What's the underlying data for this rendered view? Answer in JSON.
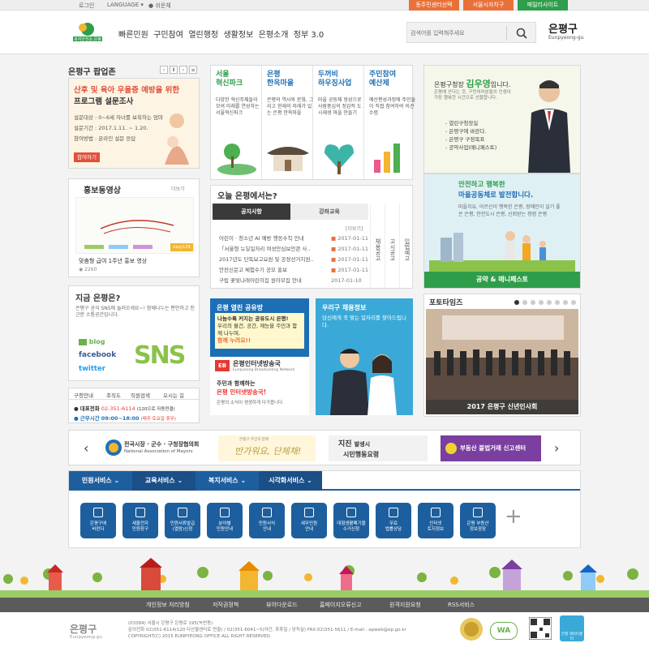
{
  "topbar": {
    "login": "로그인",
    "language": "LANGUAGE",
    "easy": "쉬운체",
    "btn_dong": "동주민센터선택",
    "btn_seoul": "서울시자치구",
    "btn_family": "패밀리사이트",
    "color_orange": "#e8713a",
    "color_green": "#2f9e4a"
  },
  "header": {
    "logo_sub": "복지안전순,은평",
    "nav": "빠른민원  구민참여  열린행정  생활정보  은평소개  정부 3.0",
    "search_placeholder": "검색어를 입력해주세요",
    "brand": "은평구",
    "brand_en": "Eunpyeong-gu"
  },
  "popup": {
    "title": "은평구 팝업존",
    "headline1": "산후 및 육아 우울증 예방을 위한",
    "headline2": "프로그램 설문조사",
    "line1": "설문대상 : 0~6세 자녀를 보육하는 엄마",
    "line2": "설문기간 : 2017.1.11. ~ 1.20.",
    "line3": "참여방법 : 온라인 설문 응답",
    "button": "참여하기"
  },
  "quick": [
    {
      "title": "서울\n혁신파크",
      "desc": "다양한 혁신주체들이 모여 미래를 연성하는 서울혁신파크",
      "color": "#2f9e4a"
    },
    {
      "title": "은평\n한옥마을",
      "desc": "은평의 역사와 문화, 그리고 현재의 미래가 있는 은평 한옥마을",
      "color": "#1f6fb5"
    },
    {
      "title": "두꺼비\n하우징사업",
      "desc": "마을 공동체 형성으로 사람중심의 정감적 도시재생 마을 만들기",
      "color": "#1f6fb5"
    },
    {
      "title": "주민참여\n예산제",
      "desc": "예산편성과정에 주민들이 직접 참여하여 의견수렴",
      "color": "#1f6fb5"
    }
  ],
  "mayor": {
    "intro": "은평구청장",
    "name": "김우영",
    "suffix": "입니다.",
    "greeting": "은평에 산다는 것, 구민여러분들의 인생이 가장 행복한 시간으로 선물합니다.",
    "items": [
      "- 열린구청장실",
      "- 은평구에 바란다.",
      "- 은평구 구정목표",
      "- 공약사업(매니페스토)"
    ]
  },
  "promo_video": {
    "title": "홍보동영상",
    "more": "더보기",
    "caption": "맞춤형 급여 1주년 홍보 영상",
    "views": "2260",
    "bar_label": "easy129"
  },
  "today": {
    "title": "오늘 은평에서는?",
    "tab1": "공지사항",
    "tab2": "강좌교육",
    "more": "[더보기]",
    "rows": [
      {
        "text": "어린이 · 청소년 AI 예방 행동수칙 안내",
        "date": "2017-01-11"
      },
      {
        "text": "「서울형 뉴딜일자리 여성안심보안관 사..",
        "date": "2017-01-11"
      },
      {
        "text": "2017년도 단독보고요원 및 공정선거지원..",
        "date": "2017-01-11"
      },
      {
        "text": "안전신문고 체험수기 공모 홍보",
        "date": "2017-01-11"
      },
      {
        "text": "구립 꽃빛나래어린이집 원아모집 안내",
        "date": "2017-01-10"
      }
    ],
    "side_cols": [
      "채용공고",
      "고시공고",
      "입법예고"
    ]
  },
  "safety": {
    "line1": "안전하고 행복한",
    "line2": "마을공동체로 발전합니다.",
    "desc": "마을치유, 어르신이 행복한 은평, 장애인이 살기 좋은 은평, 안전도시 은평, 신뢰받는 청렴 은평",
    "footer": "공약 & 매니페스토"
  },
  "now": {
    "title": "지금 은평은?",
    "desc": "은평구 공식 SNS에 놀러오세요~! 함께나누는 편안하고 친근한 소통공간입니다.",
    "blog": "blog",
    "facebook": "facebook",
    "twitter": "twitter",
    "sns": "SNS"
  },
  "share": {
    "title": "은평 열린 공유방",
    "text1": "나눔수록 커지는 공유도시 은평!",
    "text2": "우리의 물건, 공간, 재능을 주민과 함께 나누며,",
    "text3": "함께 누려요!!",
    "ebn": "은평인터넷방송국",
    "ebn_en": "Eunpyeong Broadcasting Network",
    "ebn_text1": "주민과 함께하는",
    "ebn_text2": "은평 인터넷방송국!",
    "ebn_text3": "은평의 소식이 생생하게 다가옵니다."
  },
  "jobs": {
    "title": "우리구 채용정보",
    "text": "당신에게 꼭 맞는 일자리를 찾아드립니다."
  },
  "photo": {
    "title": "포토타임즈",
    "caption": "2017 은평구 신년인사회"
  },
  "contact": {
    "tabs": [
      "구청안내",
      "조직도",
      "직원검색",
      "오시는 길"
    ],
    "phone_label": "대표전화",
    "phone": "02-351-6114",
    "phone_note": "(120으로 자동연결)",
    "hours_label": "근무시간",
    "hours": "09:00~18:00",
    "hours_note": "(매주 토요일 휴무)"
  },
  "banners": {
    "b1": "전국시장 · 군수 · 구청장협의회",
    "b1_en": "National Association of Mayors",
    "b2": "반가워요, 단체채!",
    "b2_small": "은평구 주민과 함께",
    "b3a": "지진",
    "b3b": "발생시",
    "b3c": "시민행동요령",
    "b4": "부동산 불법거래 신고센터"
  },
  "services": {
    "tabs": [
      "민원서비스",
      "교육서비스",
      "복지서비스",
      "시각화서비스"
    ],
    "icons": [
      "은평구에\n바란다",
      "새울전자\n민원창구",
      "민원서류발급\n(열람)신청",
      "분야별\n민원안내",
      "민원서식\n안내",
      "세무민원\n안내",
      "대형생활폐기물\n수거신청",
      "무료\n법률상담",
      "인터넷\n토지정보",
      "은평 부동산\n정보광장"
    ],
    "plus": "+"
  },
  "footer": {
    "menu": [
      "개인정보 처리방침",
      "저작권정책",
      "뷰어다운로드",
      "홈페이지오류신고",
      "원격지원요청",
      "RSS서비스"
    ],
    "brand": "은평구",
    "brand_en": "Eunpyeong-gu",
    "addr1": "(03384) 서울시 은평구 은평로 195(녹번동)",
    "addr2": "문의전화 02)351-6114(120 다산콜센터로 연결) / 02)351-6041~5(야간, 휴휴일 / 당직실) FAX:02)351-5611 / E-mail : epweb@ep.go.kr",
    "copy": "COPYRIGHT(C) 2015 EUNPYEONG OFFICE ALL RIGHT RESERVED.",
    "wa": "WA",
    "badge_text": "소셜미디어",
    "cloud_text": "은평 데이터센터"
  }
}
